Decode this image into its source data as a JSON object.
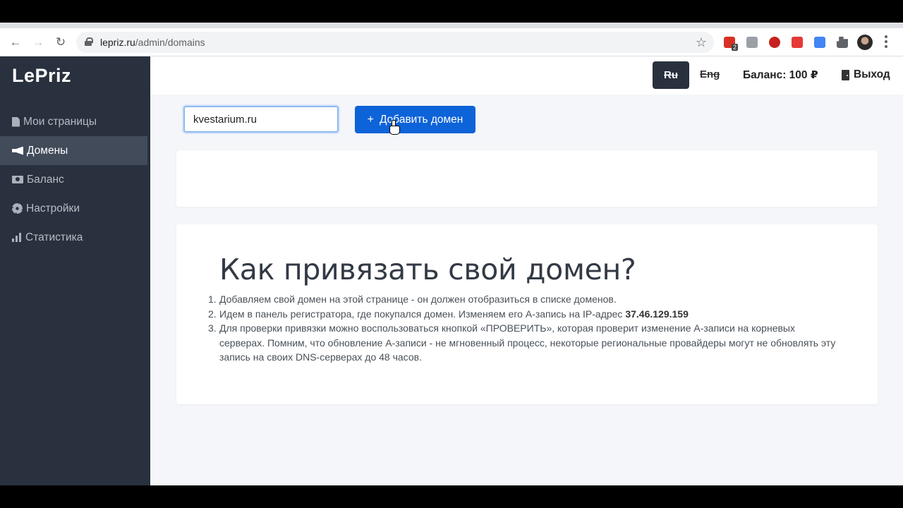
{
  "browser": {
    "url_host": "lepriz.ru",
    "url_path": "/admin/domains",
    "ext_badge": "2"
  },
  "app": {
    "logo": "LePriz"
  },
  "sidebar": {
    "items": [
      {
        "label": "Мои страницы",
        "icon": "file-icon"
      },
      {
        "label": "Домены",
        "icon": "bullhorn-icon",
        "active": true
      },
      {
        "label": "Баланс",
        "icon": "money-icon"
      },
      {
        "label": "Настройки",
        "icon": "gear-icon"
      },
      {
        "label": "Статистика",
        "icon": "bar-chart-icon"
      }
    ]
  },
  "header": {
    "lang_ru": "Ru",
    "lang_en": "Eng",
    "balance": "Баланс: 100 ₽",
    "logout": "Выход"
  },
  "domain_form": {
    "input_value": "kvestarium.ru",
    "add_button": "Добавить домен"
  },
  "info": {
    "title": "Как привязать свой домен?",
    "steps": [
      {
        "num": "1.",
        "text": "Добавляем свой домен на этой странице - он должен отобразиться в списке доменов."
      },
      {
        "num": "2.",
        "text": "Идем в панель регистратора, где покупался домен. Изменяем его A-запись на IP-адрес ",
        "bold": "37.46.129.159"
      },
      {
        "num": "3.",
        "text": "Для проверки привязки можно воспользоваться кнопкой «ПРОВЕРИТЬ», которая проверит изменение A-записи на корневых серверах. Помним, что обновление A-записи - не мгновенный процесс, некоторые региональные провайдеры могут не обновлять эту запись на своих DNS-серверах до 48 часов."
      }
    ]
  },
  "colors": {
    "sidebar_bg": "#28313d",
    "sidebar_active": "#414b5a",
    "primary": "#0d63d8",
    "page_bg": "#f4f6f9"
  }
}
